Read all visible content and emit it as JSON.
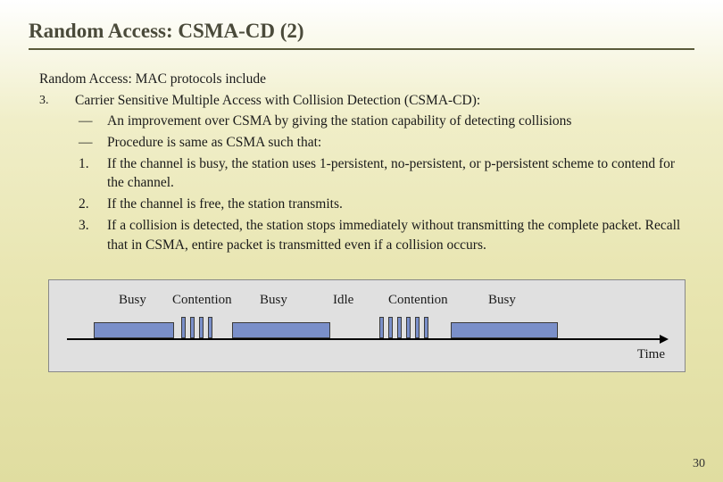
{
  "title": "Random Access: CSMA-CD (2)",
  "intro": "Random Access: MAC protocols include",
  "outer": {
    "marker": "3.",
    "text": "Carrier Sensitive Multiple Access with Collision Detection (CSMA-CD):",
    "subs": [
      {
        "marker": "—",
        "text": "An improvement over CSMA by giving the station capability of detecting collisions"
      },
      {
        "marker": "—",
        "text": "Procedure is same as CSMA such that:"
      },
      {
        "marker": "1.",
        "text": " If the channel is busy, the station uses 1-persistent, no-persistent, or p-persistent scheme to contend for the channel."
      },
      {
        "marker": "2.",
        "text": "If the channel is free, the station transmits."
      },
      {
        "marker": "3.",
        "text": "If a collision is detected, the station stops immediately without transmitting the complete packet. Recall that in CSMA, entire packet is transmitted even if a collision occurs."
      }
    ]
  },
  "diagram": {
    "labels": {
      "busy": "Busy",
      "contention": "Contention",
      "idle": "Idle",
      "time": "Time"
    }
  },
  "pageNumber": "30"
}
